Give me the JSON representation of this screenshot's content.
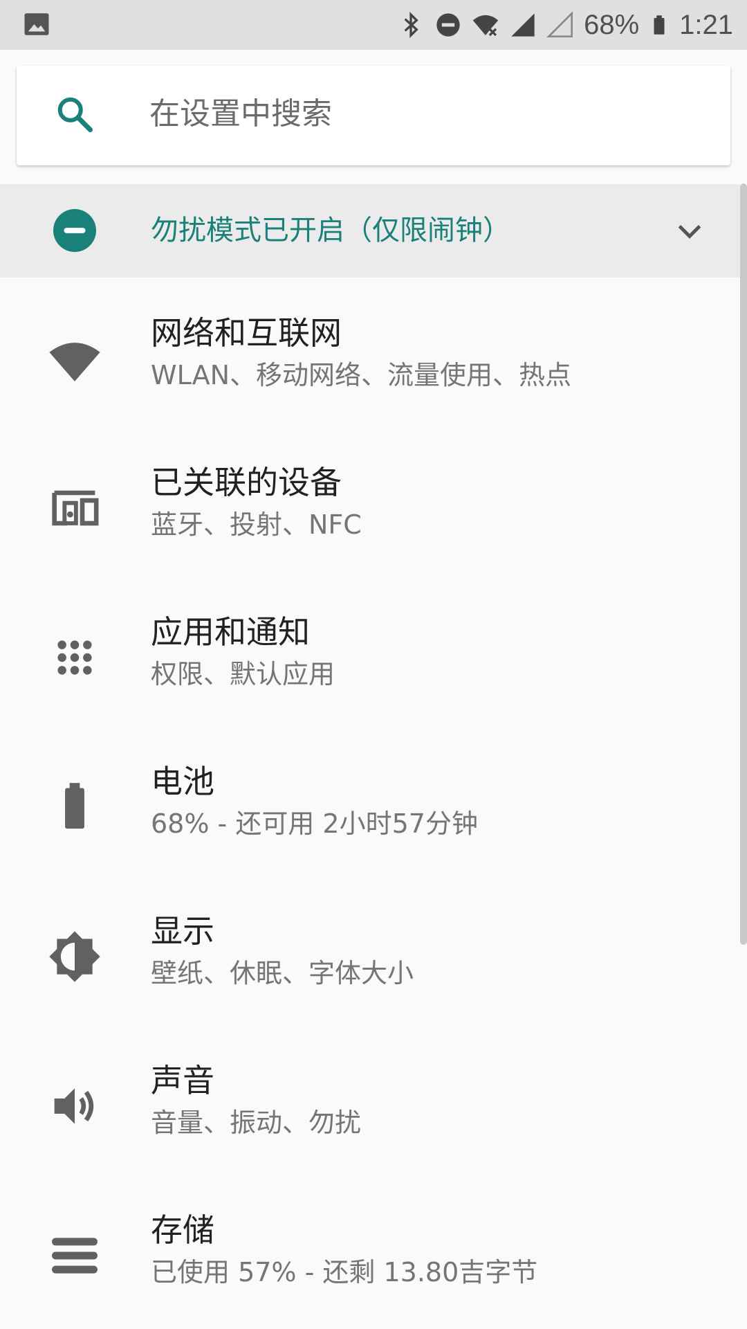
{
  "status_bar": {
    "battery_percent": "68%",
    "time": "1:21",
    "icons": [
      "image-icon",
      "bluetooth-icon",
      "do-not-disturb-icon",
      "wifi-icon",
      "signal-icon",
      "signal-empty-icon",
      "battery-icon"
    ]
  },
  "search": {
    "placeholder": "在设置中搜索"
  },
  "dnd_banner": {
    "text": "勿扰模式已开启（仅限闹钟）"
  },
  "colors": {
    "accent": "#1a807a",
    "icon_gray": "#616161",
    "banner_bg": "#ebebeb",
    "status_bg": "#e0e0e0"
  },
  "settings": [
    {
      "title": "网络和互联网",
      "subtitle": "WLAN、移动网络、流量使用、热点",
      "icon": "wifi-icon"
    },
    {
      "title": "已关联的设备",
      "subtitle": "蓝牙、投射、NFC",
      "icon": "devices-icon"
    },
    {
      "title": "应用和通知",
      "subtitle": "权限、默认应用",
      "icon": "apps-grid-icon"
    },
    {
      "title": "电池",
      "subtitle": "68% - 还可用 2小时57分钟",
      "icon": "battery-icon"
    },
    {
      "title": "显示",
      "subtitle": "壁纸、休眠、字体大小",
      "icon": "brightness-icon"
    },
    {
      "title": "声音",
      "subtitle": "音量、振动、勿扰",
      "icon": "volume-icon"
    },
    {
      "title": "存储",
      "subtitle": "已使用 57% - 还剩 13.80吉字节",
      "icon": "storage-icon"
    }
  ]
}
